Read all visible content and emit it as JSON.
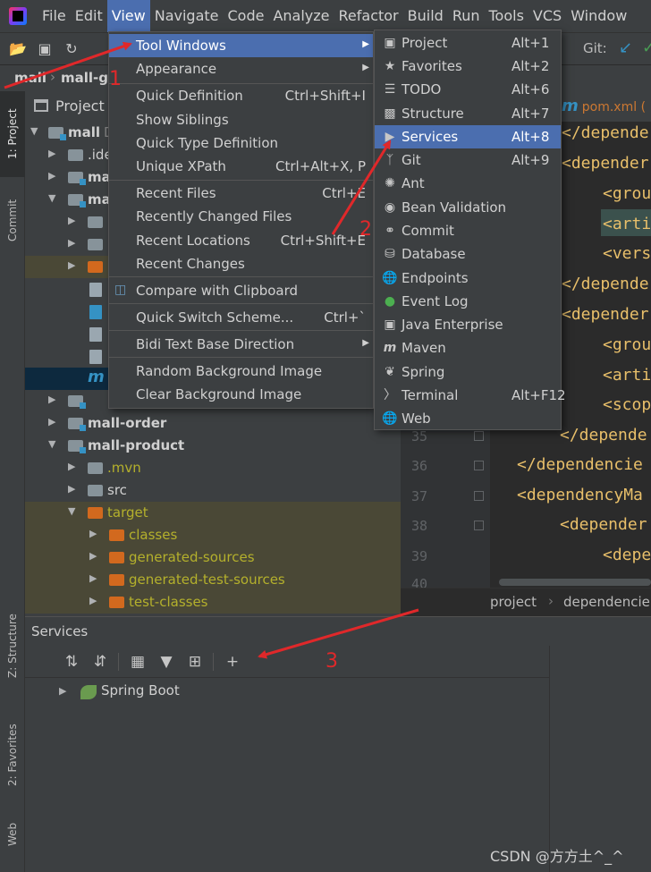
{
  "menubar": {
    "items": [
      "File",
      "Edit",
      "View",
      "Navigate",
      "Code",
      "Analyze",
      "Refactor",
      "Build",
      "Run",
      "Tools",
      "VCS",
      "Window"
    ],
    "active": "View"
  },
  "toolbar": {
    "git_label": "Git:"
  },
  "breadcrumb": {
    "root": "mall",
    "module": "mall-ga"
  },
  "left_strip": {
    "project_tab": "1: Project",
    "commit_tab": "Commit",
    "structure_tab": "Z: Structure",
    "favorites_tab": "2: Favorites",
    "web_tab": "Web"
  },
  "project_panel": {
    "title": "Project",
    "rows": [
      {
        "label": "mall",
        "suffix": "D"
      },
      {
        "label": ".ide"
      },
      {
        "label": "ma"
      },
      {
        "label": "ma"
      },
      {
        "label": ""
      },
      {
        "label": ""
      },
      {
        "label": ""
      },
      {
        "label": "mall-order"
      },
      {
        "label": "mall-product"
      },
      {
        "label": ".mvn"
      },
      {
        "label": "src"
      },
      {
        "label": "target"
      },
      {
        "label": "classes"
      },
      {
        "label": "generated-sources"
      },
      {
        "label": "generated-test-sources"
      },
      {
        "label": "test-classes"
      }
    ]
  },
  "editor": {
    "tab_label": "pom.xml (",
    "tab_icon": "m",
    "line_numbers": [
      "35",
      "36",
      "37",
      "38",
      "39",
      "40"
    ],
    "lines_upper": [
      "</depende",
      "<depender",
      "<grou",
      "<arti",
      "<vers",
      "</depende",
      "<depender",
      "<grou",
      "<arti",
      "<scop"
    ],
    "lines_lower": [
      "</depende",
      "</dependencie",
      "<dependencyMa",
      "<depender",
      "<depe"
    ],
    "crumbs": [
      "project",
      "dependencie"
    ]
  },
  "services": {
    "title": "Services",
    "tree_item": "Spring Boot"
  },
  "view_menu": {
    "items": [
      {
        "label": "Tool Windows",
        "shortcut": "",
        "submenu": true,
        "selected": true
      },
      {
        "label": "Appearance",
        "shortcut": "",
        "submenu": true
      },
      {
        "label": "Quick Definition",
        "shortcut": "Ctrl+Shift+I"
      },
      {
        "label": "Show Siblings",
        "shortcut": ""
      },
      {
        "label": "Quick Type Definition",
        "shortcut": ""
      },
      {
        "label": "Unique XPath",
        "shortcut": "Ctrl+Alt+X, P"
      },
      {
        "label": "Recent Files",
        "shortcut": "Ctrl+E"
      },
      {
        "label": "Recently Changed Files",
        "shortcut": ""
      },
      {
        "label": "Recent Locations",
        "shortcut": "Ctrl+Shift+E"
      },
      {
        "label": "Recent Changes",
        "shortcut": ""
      },
      {
        "label": "Compare with Clipboard",
        "shortcut": ""
      },
      {
        "label": "Quick Switch Scheme...",
        "shortcut": "Ctrl+`"
      },
      {
        "label": "Bidi Text Base Direction",
        "shortcut": "",
        "submenu": true
      },
      {
        "label": "Random Background Image",
        "shortcut": ""
      },
      {
        "label": "Clear Background Image",
        "shortcut": ""
      }
    ]
  },
  "tool_windows_menu": {
    "items": [
      {
        "label": "Project",
        "shortcut": "Alt+1",
        "icon": "project-icon"
      },
      {
        "label": "Favorites",
        "shortcut": "Alt+2",
        "icon": "star-icon"
      },
      {
        "label": "TODO",
        "shortcut": "Alt+6",
        "icon": "todo-icon"
      },
      {
        "label": "Structure",
        "shortcut": "Alt+7",
        "icon": "structure-icon"
      },
      {
        "label": "Services",
        "shortcut": "Alt+8",
        "icon": "services-icon",
        "selected": true
      },
      {
        "label": "Git",
        "shortcut": "Alt+9",
        "icon": "git-icon"
      },
      {
        "label": "Ant",
        "shortcut": "",
        "icon": "ant-icon"
      },
      {
        "label": "Bean Validation",
        "shortcut": "",
        "icon": "bean-validation-icon"
      },
      {
        "label": "Commit",
        "shortcut": "",
        "icon": "commit-icon"
      },
      {
        "label": "Database",
        "shortcut": "",
        "icon": "database-icon"
      },
      {
        "label": "Endpoints",
        "shortcut": "",
        "icon": "endpoints-icon"
      },
      {
        "label": "Event Log",
        "shortcut": "",
        "icon": "event-log-icon"
      },
      {
        "label": "Java Enterprise",
        "shortcut": "",
        "icon": "java-enterprise-icon"
      },
      {
        "label": "Maven",
        "shortcut": "",
        "icon": "maven-icon"
      },
      {
        "label": "Spring",
        "shortcut": "",
        "icon": "spring-icon"
      },
      {
        "label": "Terminal",
        "shortcut": "Alt+F12",
        "icon": "terminal-icon"
      },
      {
        "label": "Web",
        "shortcut": "",
        "icon": "web-icon"
      }
    ]
  },
  "annotations": {
    "step1": "1",
    "step2": "2",
    "step3": "3",
    "arrow_color": "#e0282a"
  },
  "watermark": "CSDN @方方土^_^",
  "colors": {
    "accent": "#4b6eaf",
    "background": "#2b2b2b",
    "panel": "#3c3f41",
    "xml_tag": "#e8bf6a"
  }
}
